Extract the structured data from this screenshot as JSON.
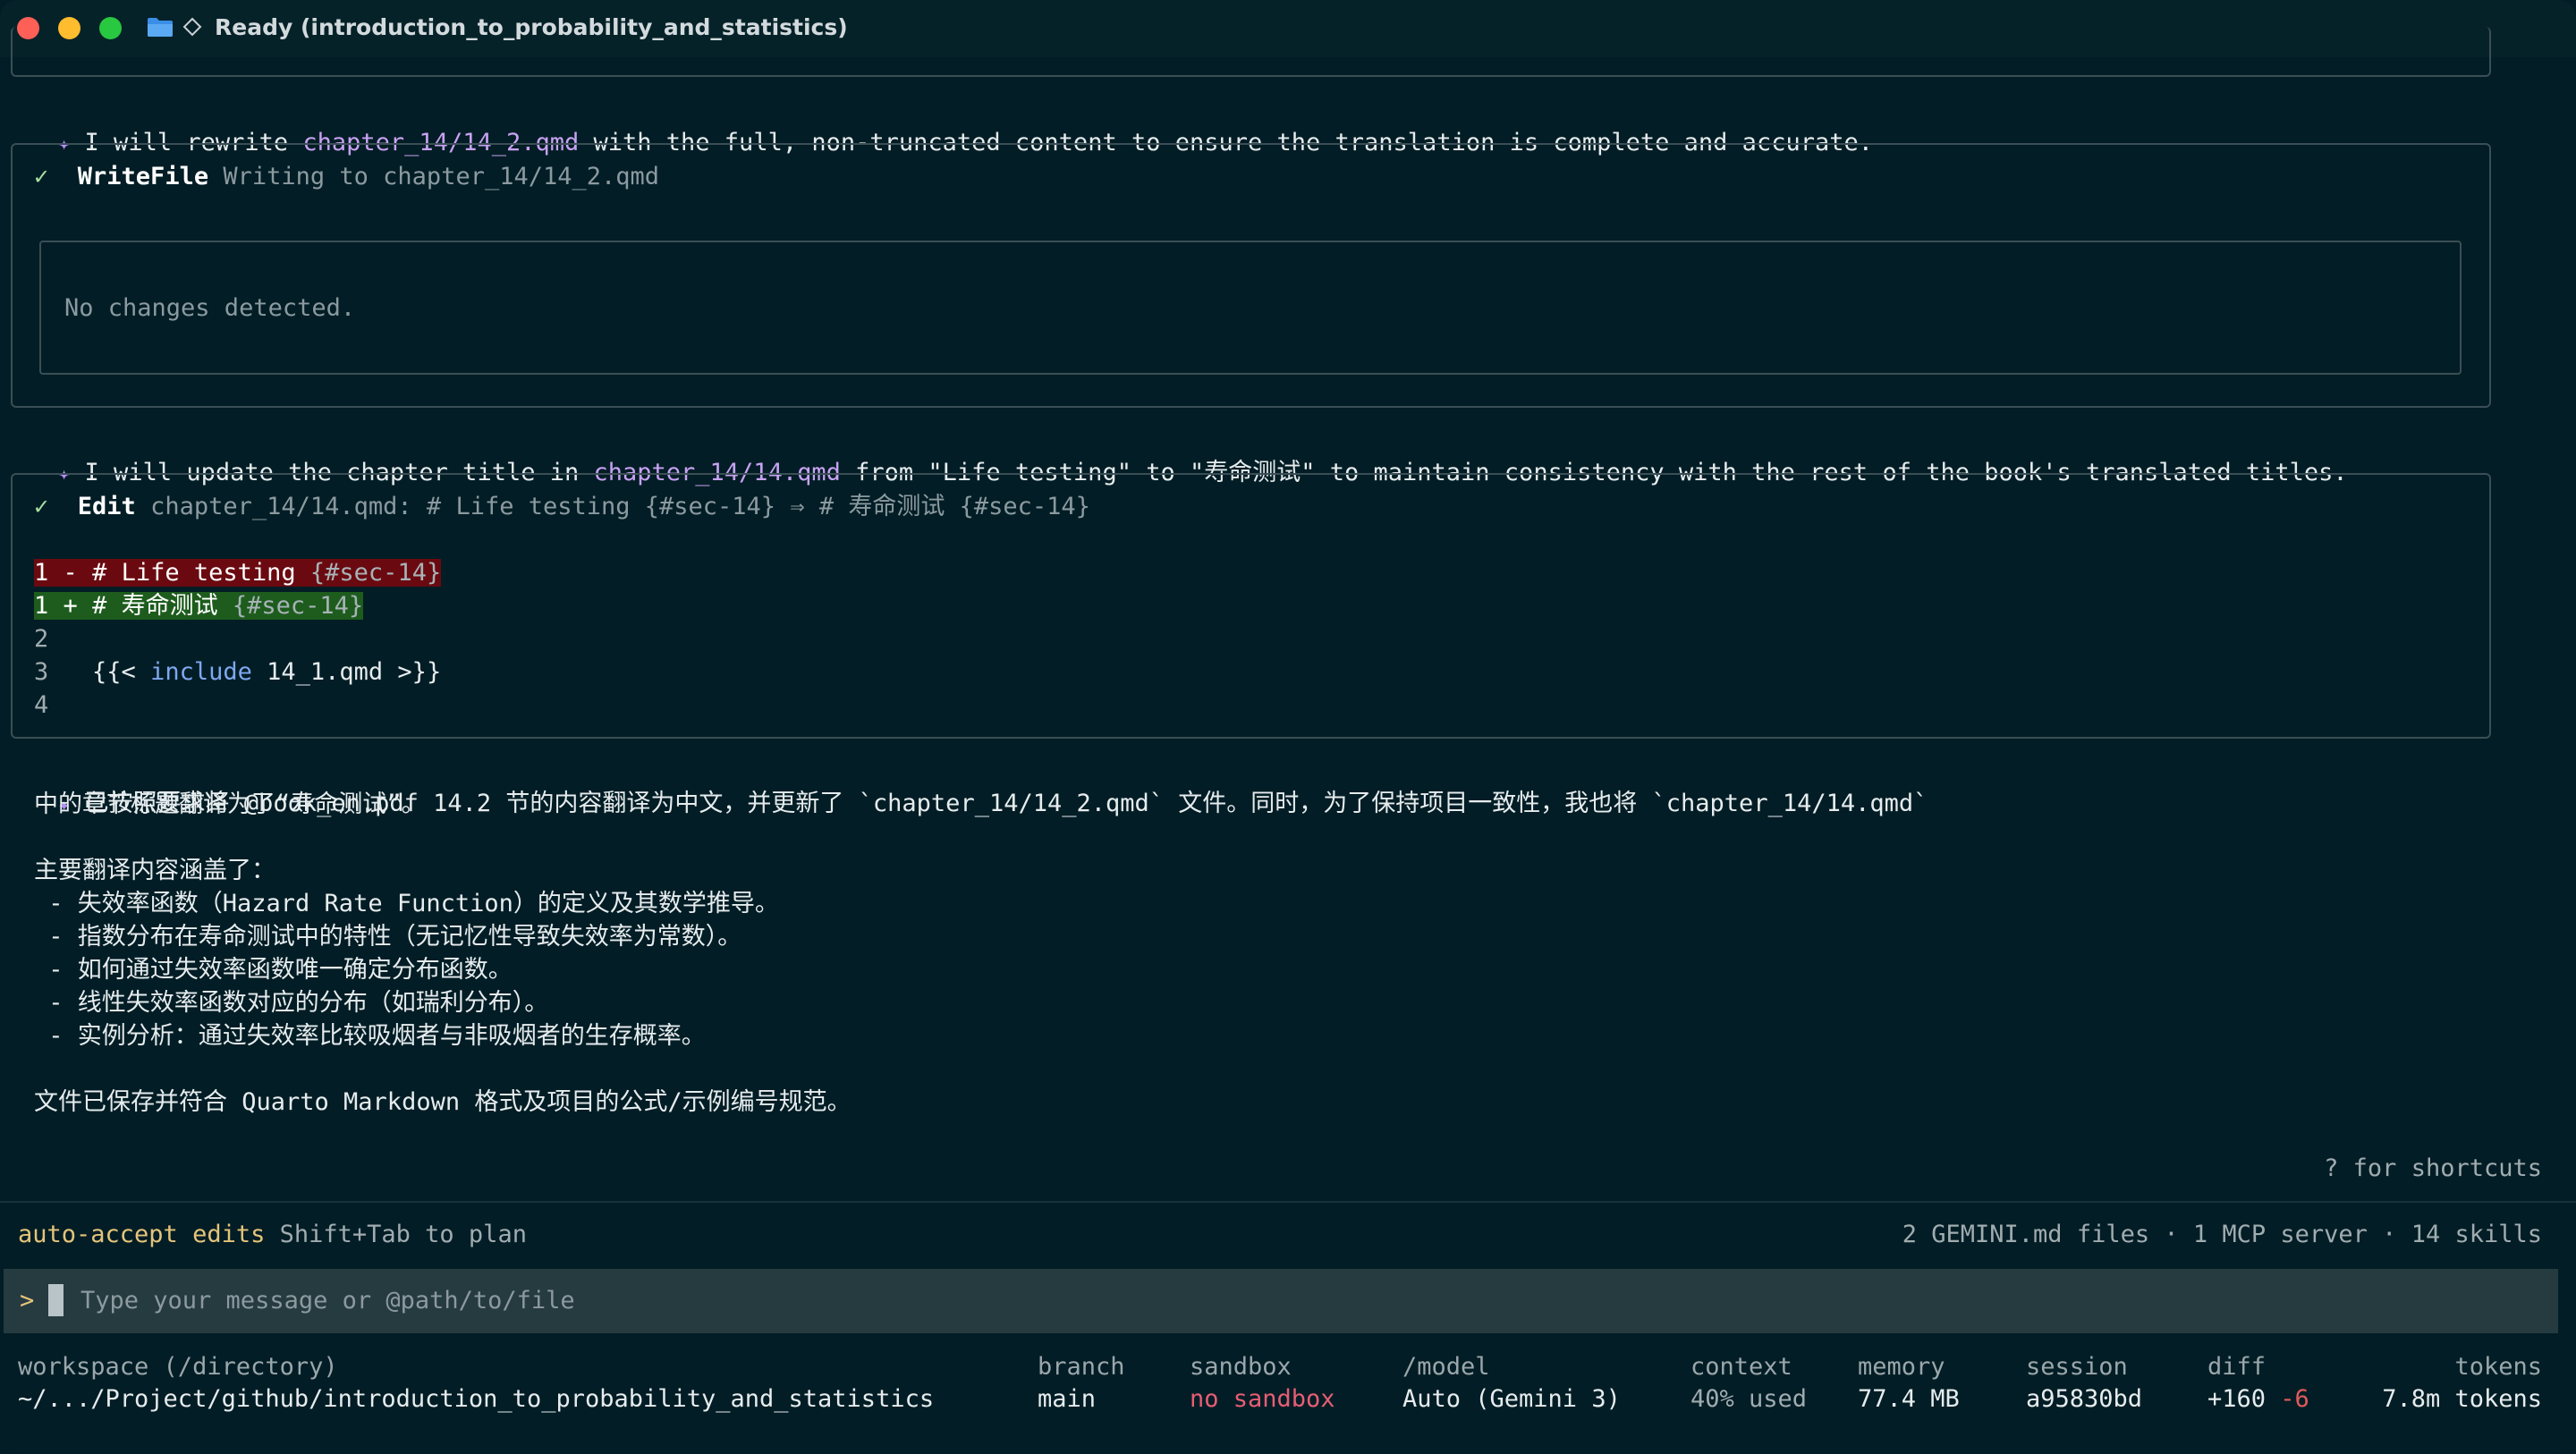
{
  "window": {
    "title": "Ready (introduction_to_probability_and_statistics)",
    "icons": [
      "folder-icon",
      "diamond-icon"
    ]
  },
  "messages": {
    "msg1": {
      "pre": "I will rewrite ",
      "file": "chapter_14/14_2.qmd",
      "post": " with the full, non-truncated content to ensure the translation is complete and accurate."
    },
    "writefile": {
      "check": "✓",
      "tool": "WriteFile",
      "desc": "Writing to chapter_14/14_2.qmd",
      "result": "No changes detected."
    },
    "msg2": {
      "pre": "I will update the chapter title in ",
      "file": "chapter_14/14.qmd",
      "post": " from \"Life testing\" to \"寿命测试\" to maintain consistency with the rest of the book's translated titles."
    },
    "edit": {
      "check": "✓",
      "tool": "Edit",
      "desc": "chapter_14/14.qmd: # Life testing {#sec-14} ⇒ # 寿命测试 {#sec-14}",
      "del_line_no": "1",
      "del_marker": "-",
      "del_text": "# Life testing ",
      "del_anchor": "{#sec-14}",
      "add_line_no": "1",
      "add_marker": "+",
      "add_text": "# 寿命测试 ",
      "add_anchor": "{#sec-14}",
      "line2_no": "2",
      "line3_no": "3",
      "line3_pre": "{{< ",
      "line3_kw": "include",
      "line3_post": " 14_1.qmd >}}",
      "line4_no": "4"
    },
    "summary": {
      "line1": "已按照要求将 @book_en.pdf 14.2 节的内容翻译为中文，并更新了 `chapter_14/14_2.qmd` 文件。同时，为了保持项目一致性，我也将 `chapter_14/14.qmd`",
      "line2": "中的章节标题翻译为了“寿命测试”。",
      "heading": "主要翻译内容涵盖了：",
      "bullets": [
        " - 失效率函数（Hazard Rate Function）的定义及其数学推导。",
        " - 指数分布在寿命测试中的特性（无记忆性导致失效率为常数）。",
        " - 如何通过失效率函数唯一确定分布函数。",
        " - 线性失效率函数对应的分布（如瑞利分布）。",
        " - 实例分析：通过失效率比较吸烟者与非吸烟者的生存概率。"
      ],
      "footer": "文件已保存并符合 Quarto Markdown 格式及项目的公式/示例编号规范。"
    }
  },
  "shortcuts_hint": "? for shortcuts",
  "mode": {
    "label": "auto-accept edits",
    "hint": "Shift+Tab to plan",
    "context_info": "2 GEMINI.md files · 1 MCP server · 14 skills"
  },
  "input": {
    "prompt": ">",
    "placeholder": "Type your message or @path/to/file"
  },
  "status": {
    "workspace_label": "workspace (/directory)",
    "workspace_value": "~/.../Project/github/introduction_to_probability_and_statistics",
    "branch_label": "branch",
    "branch_value": "main",
    "sandbox_label": "sandbox",
    "sandbox_value": "no sandbox",
    "model_label": "/model",
    "model_value": "Auto (Gemini 3)",
    "context_label": "context",
    "context_value": "40% used",
    "memory_label": "memory",
    "memory_value": "77.4 MB",
    "session_label": "session",
    "session_value": "a95830bd",
    "diff_label": "diff",
    "diff_add": "+160",
    "diff_del": "-6",
    "tokens_label": "tokens",
    "tokens_value": "7.8m tokens"
  },
  "colors": {
    "background": "#021d25",
    "accent_purple": "#c8a2f3",
    "mode_yellow": "#e5c47a",
    "sandbox_pink": "#e85d75",
    "diff_del_bg": "#6a0a10",
    "diff_add_bg": "#1d5c1d"
  }
}
